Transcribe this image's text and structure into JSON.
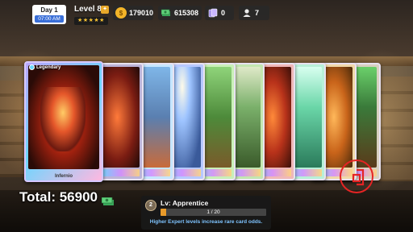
{
  "hud": {
    "day_label": "Day 1",
    "time": "07:00 AM",
    "level_label": "Level 8",
    "level_stars": "★★★★★",
    "coins": "179010",
    "cash": "615308",
    "packs": "0",
    "customers": "7",
    "icons": {
      "coins": "coin-icon",
      "cash": "cash-icon",
      "packs": "card-pack-icon",
      "customers": "customer-icon"
    }
  },
  "cards": {
    "featured_rarity": "Legendary",
    "featured_name": "Infernio",
    "count": 10
  },
  "total": {
    "label": "Total: 56900"
  },
  "expert": {
    "badge": "2",
    "level_label": "Lv: Apprentice",
    "progress_text": "1 / 20",
    "progress_fraction": 0.05,
    "hint": "Higher Expert levels increase rare card odds."
  },
  "colors": {
    "accent_orange": "#e89a2a",
    "exit_red": "#e52424",
    "hint_blue": "#7fc4ff",
    "cash_green": "#4ec26a"
  }
}
